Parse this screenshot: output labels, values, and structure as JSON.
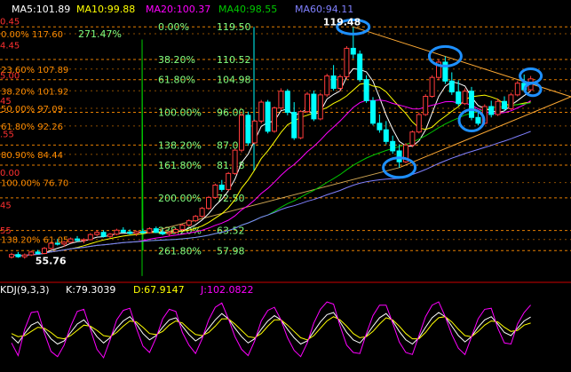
{
  "colors": {
    "background": "#000000",
    "up": "#ff3c3c",
    "down": "#00ffff",
    "ma5": "#ffffff",
    "ma10": "#ffff00",
    "ma20": "#ff00ff",
    "ma40": "#00c800",
    "ma60": "#8080ff",
    "fib_right": "#80ff80",
    "fib_left": "#ff8c00",
    "fib_line": "#ff8c00",
    "highlight_circle": "#1e90ff",
    "kdj_k": "#ffffff",
    "kdj_d": "#ffff00",
    "kdj_j": "#ff00ff",
    "separator": "#cc0000"
  },
  "legend": {
    "ma5": "MA5:101.89",
    "ma10": "MA10:99.88",
    "ma20": "MA20:100.37",
    "ma40": "MA40:98.55",
    "ma60": "MA60:94.11"
  },
  "kdj_legend": {
    "name": "KDJ(9,3,3)",
    "k": "K:79.3039",
    "d": "D:67.9147",
    "j": "J:102.0822"
  },
  "price_annotations": {
    "high": "119.48",
    "low": "55.76"
  },
  "chart_data": {
    "type": "candlestick",
    "ylim": [
      50,
      122
    ],
    "fib_right": [
      {
        "pct": "0.00%",
        "price": "119.50",
        "value": 119.5
      },
      {
        "pct": "38.20%",
        "price": "110.52",
        "value": 110.52
      },
      {
        "pct": "61.80%",
        "price": "104.98",
        "value": 104.98
      },
      {
        "pct": "100.00%",
        "price": "96.00",
        "value": 96.0
      },
      {
        "pct": "138.20%",
        "price": "87.02",
        "value": 87.02
      },
      {
        "pct": "161.80%",
        "price": "81.48",
        "value": 81.48
      },
      {
        "pct": "200.00%",
        "price": "72.50",
        "value": 72.5
      },
      {
        "pct": "238.20%",
        "price": "63.52",
        "value": 63.52
      },
      {
        "pct": "261.80%",
        "price": "57.98",
        "value": 57.98
      }
    ],
    "fib_left": [
      {
        "text": "0.00% 117.60",
        "value": 117.6
      },
      {
        "text": "23.60% 107.89",
        "value": 107.89
      },
      {
        "text": "38.20% 101.92",
        "value": 101.92
      },
      {
        "text": "50.00% 97.09",
        "value": 97.09
      },
      {
        "text": "61.80% 92.26",
        "value": 92.26
      },
      {
        "text": "80.90% 84.44",
        "value": 84.44
      },
      {
        "text": "100.00% 76.70",
        "value": 76.7
      },
      {
        "text": "138.20% 61.05",
        "value": 61.05
      }
    ],
    "fib_left_percent": "271.47%",
    "left_axis_fragments": [
      {
        "text": "0.45",
        "value": 121.2
      },
      {
        "text": "4.45",
        "value": 114.6
      },
      {
        "text": "5.00",
        "value": 106.2
      },
      {
        "text": "45",
        "value": 99.3
      },
      {
        "text": ".55",
        "value": 90.2
      },
      {
        "text": "0.00",
        "value": 79.5
      },
      {
        "text": "45",
        "value": 70.6
      },
      {
        "text": "55",
        "value": 63.7
      }
    ],
    "candles": [
      [
        56.2,
        57.4,
        55.8,
        56.9
      ],
      [
        56.9,
        57.6,
        56.0,
        56.3
      ],
      [
        56.3,
        57.2,
        55.76,
        56.8
      ],
      [
        56.8,
        58.0,
        56.5,
        57.6
      ],
      [
        57.6,
        58.2,
        57.0,
        57.2
      ],
      [
        57.2,
        59.0,
        57.0,
        58.6
      ],
      [
        58.6,
        60.4,
        58.3,
        60.0
      ],
      [
        60.0,
        61.2,
        59.4,
        59.8
      ],
      [
        59.8,
        60.6,
        59.0,
        60.3
      ],
      [
        60.3,
        61.6,
        60.0,
        61.2
      ],
      [
        61.2,
        62.0,
        60.4,
        60.8
      ],
      [
        60.8,
        61.4,
        60.0,
        61.0
      ],
      [
        61.0,
        62.8,
        60.8,
        62.4
      ],
      [
        62.4,
        63.6,
        62.0,
        63.0
      ],
      [
        63.0,
        63.6,
        61.6,
        61.9
      ],
      [
        61.9,
        62.8,
        61.4,
        62.5
      ],
      [
        62.5,
        64.0,
        62.2,
        63.6
      ],
      [
        63.6,
        64.4,
        62.8,
        63.1
      ],
      [
        63.1,
        63.8,
        62.4,
        62.7
      ],
      [
        62.7,
        63.5,
        62.0,
        63.2
      ],
      [
        63.2,
        64.0,
        62.6,
        62.9
      ],
      [
        62.9,
        64.4,
        62.7,
        64.0
      ],
      [
        64.0,
        64.6,
        62.8,
        63.0
      ],
      [
        63.0,
        63.8,
        62.2,
        62.6
      ],
      [
        62.6,
        63.4,
        62.0,
        63.0
      ],
      [
        63.0,
        64.2,
        62.6,
        63.8
      ],
      [
        63.8,
        65.4,
        63.4,
        65.0
      ],
      [
        65.0,
        66.6,
        64.6,
        66.2
      ],
      [
        66.2,
        67.8,
        65.8,
        67.4
      ],
      [
        67.4,
        70.0,
        67.0,
        69.6
      ],
      [
        69.6,
        73.0,
        69.2,
        72.6
      ],
      [
        72.6,
        76.4,
        72.2,
        76.0
      ],
      [
        76.0,
        77.4,
        74.2,
        74.8
      ],
      [
        74.8,
        79.6,
        74.4,
        79.2
      ],
      [
        79.2,
        86.0,
        78.8,
        85.6
      ],
      [
        85.6,
        95.8,
        85.0,
        95.2
      ],
      [
        95.2,
        96.2,
        86.8,
        87.6
      ],
      [
        87.6,
        94.0,
        87.2,
        93.6
      ],
      [
        93.6,
        99.4,
        93.0,
        98.8
      ],
      [
        98.8,
        99.4,
        90.2,
        90.8
      ],
      [
        90.8,
        97.6,
        90.4,
        97.2
      ],
      [
        97.2,
        102.6,
        96.6,
        101.8
      ],
      [
        101.8,
        102.4,
        95.2,
        96.0
      ],
      [
        96.0,
        98.8,
        88.4,
        89.0
      ],
      [
        89.0,
        96.6,
        88.6,
        96.2
      ],
      [
        96.2,
        101.6,
        95.8,
        101.0
      ],
      [
        101.0,
        102.0,
        93.6,
        94.2
      ],
      [
        94.2,
        101.4,
        93.8,
        100.8
      ],
      [
        100.8,
        106.6,
        100.2,
        106.0
      ],
      [
        106.0,
        109.0,
        102.0,
        102.6
      ],
      [
        102.6,
        106.4,
        101.8,
        105.8
      ],
      [
        105.8,
        114.2,
        105.2,
        113.6
      ],
      [
        113.6,
        119.48,
        110.8,
        112.0
      ],
      [
        112.0,
        113.0,
        104.4,
        105.0
      ],
      [
        105.0,
        106.2,
        98.6,
        99.2
      ],
      [
        99.2,
        100.2,
        92.4,
        93.0
      ],
      [
        93.0,
        95.4,
        90.4,
        91.2
      ],
      [
        91.2,
        93.6,
        87.2,
        88.0
      ],
      [
        88.0,
        89.6,
        84.6,
        85.4
      ],
      [
        85.4,
        87.2,
        80.8,
        82.4
      ],
      [
        82.4,
        87.6,
        82.0,
        87.0
      ],
      [
        87.0,
        91.0,
        86.4,
        90.6
      ],
      [
        90.6,
        96.0,
        90.2,
        95.4
      ],
      [
        95.4,
        101.0,
        95.0,
        100.4
      ],
      [
        100.4,
        106.2,
        100.0,
        105.6
      ],
      [
        105.6,
        110.6,
        104.8,
        109.8
      ],
      [
        109.8,
        111.4,
        103.8,
        104.6
      ],
      [
        104.6,
        107.0,
        100.8,
        101.6
      ],
      [
        101.6,
        104.8,
        97.8,
        98.4
      ],
      [
        98.4,
        102.6,
        98.0,
        101.8
      ],
      [
        101.8,
        103.0,
        93.8,
        94.6
      ],
      [
        94.6,
        96.4,
        92.4,
        93.0
      ],
      [
        93.0,
        98.2,
        92.6,
        97.6
      ],
      [
        97.6,
        99.2,
        94.6,
        95.4
      ],
      [
        95.4,
        99.8,
        95.0,
        99.0
      ],
      [
        99.0,
        100.4,
        96.4,
        97.0
      ],
      [
        97.0,
        101.4,
        96.6,
        100.8
      ],
      [
        100.8,
        104.6,
        100.4,
        104.0
      ],
      [
        104.0,
        106.4,
        101.6,
        102.2
      ],
      [
        102.2,
        106.0,
        101.8,
        105.2
      ]
    ],
    "kdj": {
      "k": [
        42,
        30,
        48,
        64,
        70,
        55,
        38,
        28,
        34,
        50,
        66,
        74,
        60,
        42,
        30,
        40,
        58,
        72,
        80,
        66,
        48,
        36,
        44,
        60,
        74,
        78,
        62,
        46,
        34,
        42,
        58,
        74,
        86,
        76,
        58,
        42,
        30,
        38,
        56,
        72,
        82,
        74,
        56,
        40,
        28,
        34,
        52,
        70,
        84,
        88,
        70,
        50,
        36,
        30,
        44,
        62,
        78,
        86,
        72,
        52,
        36,
        28,
        40,
        60,
        78,
        88,
        80,
        62,
        44,
        32,
        42,
        60,
        74,
        80,
        66,
        50,
        44,
        58,
        72,
        79.3
      ],
      "d": [
        48,
        42,
        44,
        52,
        60,
        58,
        50,
        40,
        38,
        44,
        54,
        64,
        62,
        54,
        44,
        42,
        50,
        62,
        72,
        70,
        60,
        48,
        46,
        52,
        64,
        72,
        68,
        56,
        46,
        44,
        50,
        62,
        76,
        76,
        66,
        54,
        42,
        40,
        48,
        62,
        74,
        74,
        64,
        52,
        40,
        36,
        44,
        58,
        72,
        80,
        74,
        62,
        48,
        40,
        42,
        52,
        66,
        78,
        74,
        62,
        48,
        38,
        38,
        50,
        66,
        78,
        80,
        70,
        56,
        44,
        42,
        52,
        64,
        72,
        70,
        60,
        52,
        54,
        64,
        67.9
      ],
      "j": [
        30,
        6,
        56,
        88,
        90,
        49,
        14,
        4,
        26,
        62,
        90,
        94,
        56,
        18,
        2,
        36,
        74,
        92,
        96,
        58,
        24,
        12,
        40,
        76,
        94,
        90,
        50,
        26,
        10,
        38,
        74,
        98,
        106,
        76,
        42,
        18,
        6,
        34,
        72,
        92,
        98,
        74,
        40,
        16,
        4,
        30,
        68,
        94,
        108,
        104,
        62,
        26,
        12,
        10,
        48,
        82,
        102,
        102,
        68,
        32,
        12,
        8,
        44,
        80,
        102,
        108,
        80,
        46,
        20,
        8,
        42,
        76,
        94,
        96,
        58,
        30,
        28,
        66,
        88,
        102.1
      ]
    }
  }
}
